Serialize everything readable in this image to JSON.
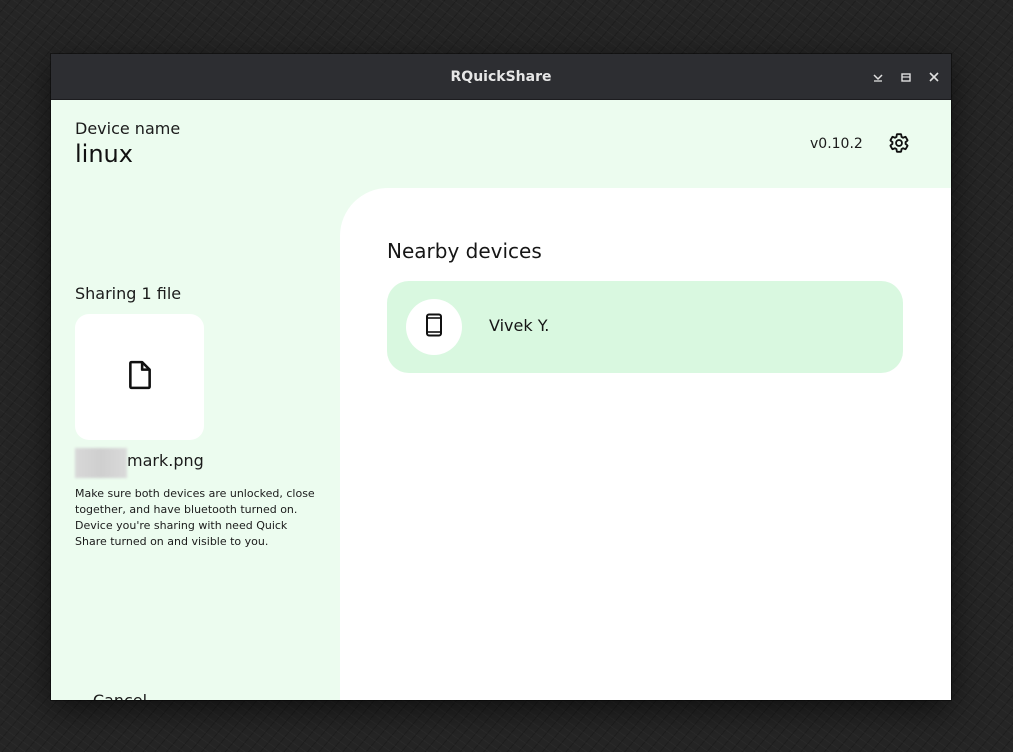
{
  "window": {
    "title": "RQuickShare",
    "controls": [
      "minimize-icon",
      "maximize-icon",
      "close-icon"
    ]
  },
  "header": {
    "device_label": "Device name",
    "device_name": "linux",
    "version": "v0.10.2",
    "settings_icon": "gear-icon"
  },
  "sidebar": {
    "sharing_label": "Sharing 1 file",
    "file_icon": "file-icon",
    "file_name": "mark.png",
    "hint": "Make sure both devices are unlocked, close together, and have bluetooth turned on. Device you're sharing with need Quick Share turned on and visible to you.",
    "cancel_label": "Cancel"
  },
  "main": {
    "title": "Nearby devices",
    "devices": [
      {
        "name": "Vivek Y.",
        "icon": "smartphone-icon"
      }
    ]
  },
  "colors": {
    "titlebar": "#2d2e32",
    "background": "#ecfcef",
    "panel": "#ffffff",
    "device_card": "#d9f8e0"
  }
}
